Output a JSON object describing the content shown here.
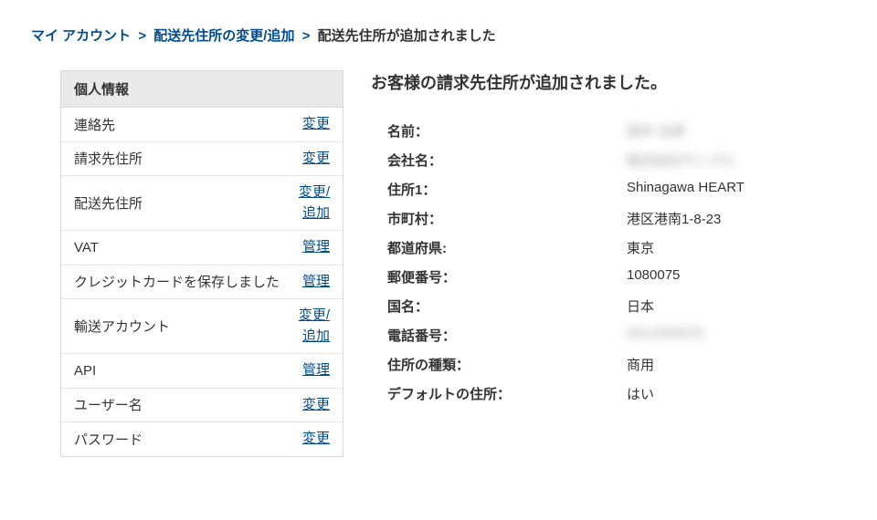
{
  "breadcrumb": {
    "item1": "マイ アカウント",
    "item2": "配送先住所の変更/追加",
    "current": "配送先住所が追加されました"
  },
  "sidebar": {
    "header": "個人情報",
    "rows": [
      {
        "label": "連絡先",
        "action": "変更"
      },
      {
        "label": "請求先住所",
        "action": "変更"
      },
      {
        "label": "配送先住所",
        "action": "変更/\n追加"
      },
      {
        "label": "VAT",
        "action": "管理"
      },
      {
        "label": "クレジットカードを保存しました",
        "action": "管理"
      },
      {
        "label": "輸送アカウント",
        "action": "変更/\n追加"
      },
      {
        "label": "API",
        "action": "管理"
      },
      {
        "label": "ユーザー名",
        "action": "変更"
      },
      {
        "label": "パスワード",
        "action": "変更"
      }
    ]
  },
  "main": {
    "title": "お客様の請求先住所が追加されました。",
    "fields": [
      {
        "label": "名前：",
        "value": "田中 太郎",
        "blurred": true
      },
      {
        "label": "会社名：",
        "value": "株式会社サンプル",
        "blurred": true
      },
      {
        "label": "住所1：",
        "value": "Shinagawa HEART",
        "blurred": false
      },
      {
        "label": "市町村：",
        "value": "港区港南1-8-23",
        "blurred": false
      },
      {
        "label": "都道府県:",
        "value": "東京",
        "blurred": false
      },
      {
        "label": "郵便番号：",
        "value": "1080075",
        "blurred": false
      },
      {
        "label": "国名：",
        "value": "日本",
        "blurred": false
      },
      {
        "label": "電話番号：",
        "value": "0312345678",
        "blurred": true
      },
      {
        "label": "住所の種類：",
        "value": "商用",
        "blurred": false
      },
      {
        "label": "デフォルトの住所：",
        "value": "はい",
        "blurred": false
      }
    ]
  }
}
